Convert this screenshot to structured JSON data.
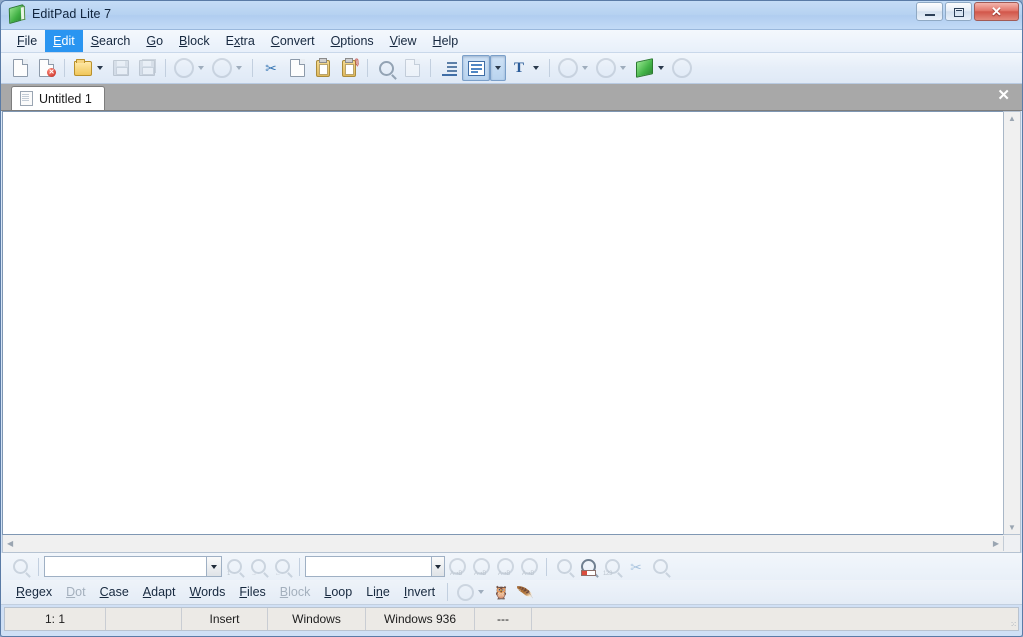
{
  "window": {
    "title": "EditPad Lite 7",
    "logo_icon": "green-book-icon",
    "controls": {
      "minimize": "minimize-icon",
      "restore": "restore-icon",
      "close": "✕"
    }
  },
  "menubar": {
    "items": [
      {
        "label": "File",
        "accel": "F",
        "active": false
      },
      {
        "label": "Edit",
        "accel": "E",
        "active": true
      },
      {
        "label": "Search",
        "accel": "S",
        "active": false
      },
      {
        "label": "Go",
        "accel": "G",
        "active": false
      },
      {
        "label": "Block",
        "accel": "B",
        "active": false
      },
      {
        "label": "Extra",
        "accel": "x",
        "active": false
      },
      {
        "label": "Convert",
        "accel": "C",
        "active": false
      },
      {
        "label": "Options",
        "accel": "O",
        "active": false
      },
      {
        "label": "View",
        "accel": "V",
        "active": false
      },
      {
        "label": "Help",
        "accel": "H",
        "active": false
      }
    ]
  },
  "toolbar": {
    "buttons": [
      {
        "name": "new-file-icon",
        "enabled": true
      },
      {
        "name": "close-file-icon",
        "enabled": true
      },
      {
        "name": "sep"
      },
      {
        "name": "open-file-icon",
        "enabled": true,
        "dropdown": true
      },
      {
        "name": "save-icon",
        "enabled": false
      },
      {
        "name": "save-all-icon",
        "enabled": false
      },
      {
        "name": "sep"
      },
      {
        "name": "undo-icon",
        "enabled": false,
        "dropdown": true
      },
      {
        "name": "redo-icon",
        "enabled": false,
        "dropdown": true
      },
      {
        "name": "sep"
      },
      {
        "name": "cut-icon",
        "enabled": true
      },
      {
        "name": "copy-icon",
        "enabled": true
      },
      {
        "name": "paste-icon",
        "enabled": true
      },
      {
        "name": "paste-special-icon",
        "enabled": true
      },
      {
        "name": "sep"
      },
      {
        "name": "search-icon",
        "enabled": true
      },
      {
        "name": "replace-icon",
        "enabled": false
      },
      {
        "name": "sep"
      },
      {
        "name": "indent-icon",
        "enabled": true
      },
      {
        "name": "word-wrap-icon",
        "enabled": true,
        "pressed": true,
        "dropdown": true
      },
      {
        "name": "font-icon",
        "enabled": true,
        "dropdown": true
      },
      {
        "name": "sep"
      },
      {
        "name": "navigate-back-icon",
        "enabled": false,
        "dropdown": true
      },
      {
        "name": "navigate-forward-icon",
        "enabled": false,
        "dropdown": true
      },
      {
        "name": "editpad-book-icon",
        "enabled": true,
        "dropdown": true
      },
      {
        "name": "reload-icon",
        "enabled": false
      }
    ]
  },
  "tabs": {
    "items": [
      {
        "label": "Untitled 1",
        "icon": "document-icon",
        "active": true
      }
    ],
    "close_label": "✕"
  },
  "editor": {
    "content": "",
    "scroll_up": "▲",
    "scroll_down": "▼",
    "scroll_left": "◀",
    "scroll_right": "▶"
  },
  "findbar": {
    "search_icon": "magnifier-icon",
    "search_value": "",
    "search_placeholder": "",
    "replace_value": "",
    "replace_placeholder": "",
    "dropdown_icon": "chevron-down-icon",
    "search_buttons": [
      {
        "name": "count-matches-icon",
        "badge": "1",
        "enabled": false
      },
      {
        "name": "find-next-icon",
        "badge": "→",
        "enabled": false
      },
      {
        "name": "find-previous-icon",
        "badge": "←",
        "enabled": false
      }
    ],
    "replace_buttons": [
      {
        "name": "replace-all-icon",
        "badge": "A⇒B",
        "enabled": false
      },
      {
        "name": "replace-next-icon",
        "badge": "A⇒B",
        "enabled": false
      },
      {
        "name": "replace-previous-icon",
        "badge": "A⇒B",
        "enabled": false
      },
      {
        "name": "replace-selection-icon",
        "badge": "A⇒B",
        "enabled": false
      }
    ],
    "extra_buttons": [
      {
        "name": "search-files-icon",
        "enabled": false
      },
      {
        "name": "highlight-icon",
        "enabled": true
      },
      {
        "name": "numbered-list-icon",
        "badge": "123",
        "enabled": false
      },
      {
        "name": "cut-matches-icon",
        "enabled": false
      },
      {
        "name": "preview-icon",
        "enabled": false
      }
    ]
  },
  "options": {
    "items": [
      {
        "label": "Regex",
        "accel": "R",
        "enabled": true
      },
      {
        "label": "Dot",
        "accel": "D",
        "enabled": false
      },
      {
        "label": "Case",
        "accel": "C",
        "enabled": true
      },
      {
        "label": "Adapt",
        "accel": "A",
        "enabled": true
      },
      {
        "label": "Words",
        "accel": "W",
        "enabled": true
      },
      {
        "label": "Files",
        "accel": "F",
        "enabled": true
      },
      {
        "label": "Block",
        "accel": "B",
        "enabled": false
      },
      {
        "label": "Loop",
        "accel": "L",
        "enabled": true
      },
      {
        "label": "Line",
        "accel": "n",
        "enabled": true
      },
      {
        "label": "Invert",
        "accel": "I",
        "enabled": true
      }
    ],
    "history_icon": "download-history-icon",
    "owl_icon": "owl-icon",
    "quill_icon": "quill-icon"
  },
  "statusbar": {
    "cells": [
      {
        "name": "cursor-position",
        "text": "1: 1"
      },
      {
        "name": "selection-info",
        "text": ""
      },
      {
        "name": "insert-mode",
        "text": "Insert"
      },
      {
        "name": "line-breaks",
        "text": "Windows"
      },
      {
        "name": "encoding",
        "text": "Windows 936"
      },
      {
        "name": "file-info",
        "text": "---"
      },
      {
        "name": "status-spacer",
        "text": ""
      }
    ]
  }
}
